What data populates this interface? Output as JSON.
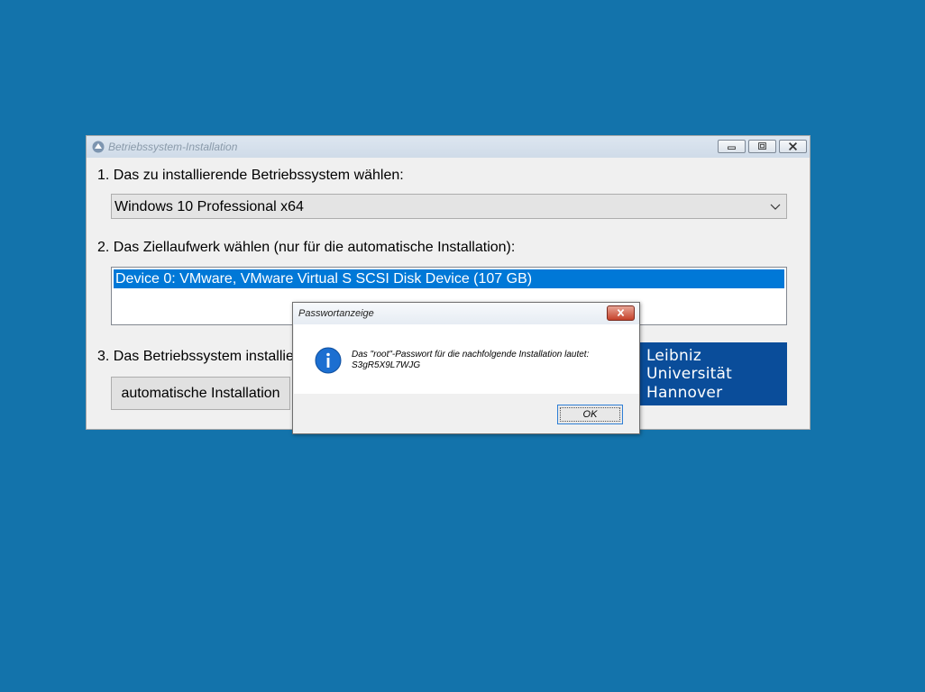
{
  "main_window": {
    "title": "Betriebssystem-Installation",
    "step1_label": "1. Das zu installierende Betriebssystem wählen:",
    "os_selected": "Windows 10 Professional x64",
    "step2_label": "2. Das Ziellaufwerk wählen (nur für die automatische Installation):",
    "drives": [
      "Device 0: VMware, VMware Virtual S SCSI Disk Device (107 GB)"
    ],
    "step3_label": "3. Das Betriebssystem installieren:",
    "auto_install_button": "automatische Installation",
    "logo_lines": [
      "Leibniz",
      "Universität",
      "Hannover"
    ]
  },
  "dialog": {
    "title": "Passwortanzeige",
    "message_line1": "Das \"root\"-Passwort für die nachfolgende Installation lautet:",
    "message_line2": "S3gR5X9L7WJG",
    "ok_button": "OK"
  },
  "colors": {
    "desktop": "#1373ab",
    "selection": "#0078d7",
    "logo_bg": "#0a4d9a"
  }
}
